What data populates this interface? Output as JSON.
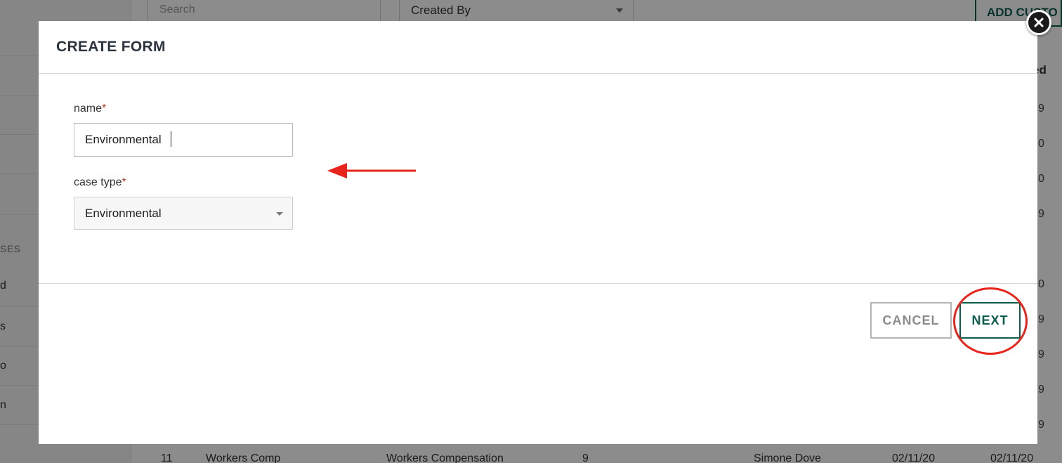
{
  "background": {
    "search_placeholder": "Search",
    "created_by_filter": "Created By",
    "add_button_label": "ADD CUSTO",
    "column_header_fragment": "ed",
    "sidebar_section_fragment": "SES",
    "sidebar_fragments": [
      "d",
      "s",
      "o",
      "n"
    ],
    "right_column_fragments": [
      "9",
      "0",
      "0",
      "9",
      "0",
      "9",
      "9",
      "9",
      "9",
      "0"
    ],
    "table_row": {
      "id": "11",
      "name": "Workers Comp",
      "case_type": "Workers Compensation",
      "count": "9",
      "created_by": "Simone Dove",
      "created": "02/11/20",
      "modified": "02/11/20"
    }
  },
  "modal": {
    "title": "CREATE FORM",
    "name_label": "name",
    "name_value": "Environmental",
    "case_type_label": "case type",
    "case_type_value": "Environmental",
    "required_marker": "*",
    "cancel_label": "CANCEL",
    "next_label": "NEXT"
  },
  "colors": {
    "accent": "#0d5d4e",
    "annotation": "#e8241c",
    "required": "#c0392b"
  },
  "icons": {
    "close": "close-icon",
    "select_caret": "chevron-down-icon",
    "annotation_arrow": "arrow-left-icon"
  }
}
